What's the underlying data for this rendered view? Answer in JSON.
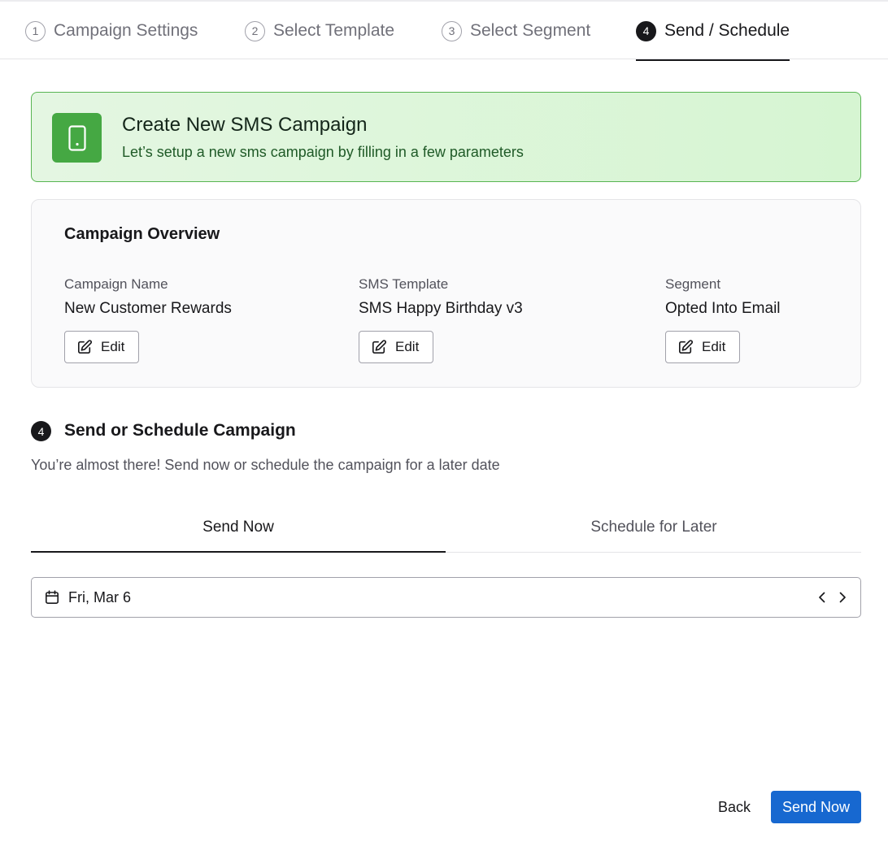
{
  "stepper": {
    "steps": [
      {
        "number": "1",
        "label": "Campaign Settings",
        "active": false
      },
      {
        "number": "2",
        "label": "Select Template",
        "active": false
      },
      {
        "number": "3",
        "label": "Select Segment",
        "active": false
      },
      {
        "number": "4",
        "label": "Send / Schedule",
        "active": true
      }
    ]
  },
  "banner": {
    "icon": "mobile-phone-icon",
    "title": "Create New SMS Campaign",
    "subtitle": "Let’s setup a new sms campaign by filling in a few parameters",
    "accent": "#45a843"
  },
  "overview": {
    "title": "Campaign Overview",
    "items": [
      {
        "label": "Campaign Name",
        "value": "New Customer Rewards",
        "edit_label": "Edit"
      },
      {
        "label": "SMS Template",
        "value": "SMS Happy Birthday v3",
        "edit_label": "Edit"
      },
      {
        "label": "Segment",
        "value": "Opted Into Email",
        "edit_label": "Edit"
      }
    ]
  },
  "section": {
    "number": "4",
    "title": "Send or Schedule Campaign",
    "description": "You’re almost there! Send now or schedule the campaign for a later date"
  },
  "tabs": {
    "items": [
      {
        "label": "Send Now",
        "active": true
      },
      {
        "label": "Schedule for Later",
        "active": false
      }
    ]
  },
  "datepicker": {
    "value": "Fri, Mar 6",
    "icon": "calendar-icon"
  },
  "footer": {
    "back_label": "Back",
    "send_label": "Send Now",
    "primary_color": "#1768d0"
  }
}
